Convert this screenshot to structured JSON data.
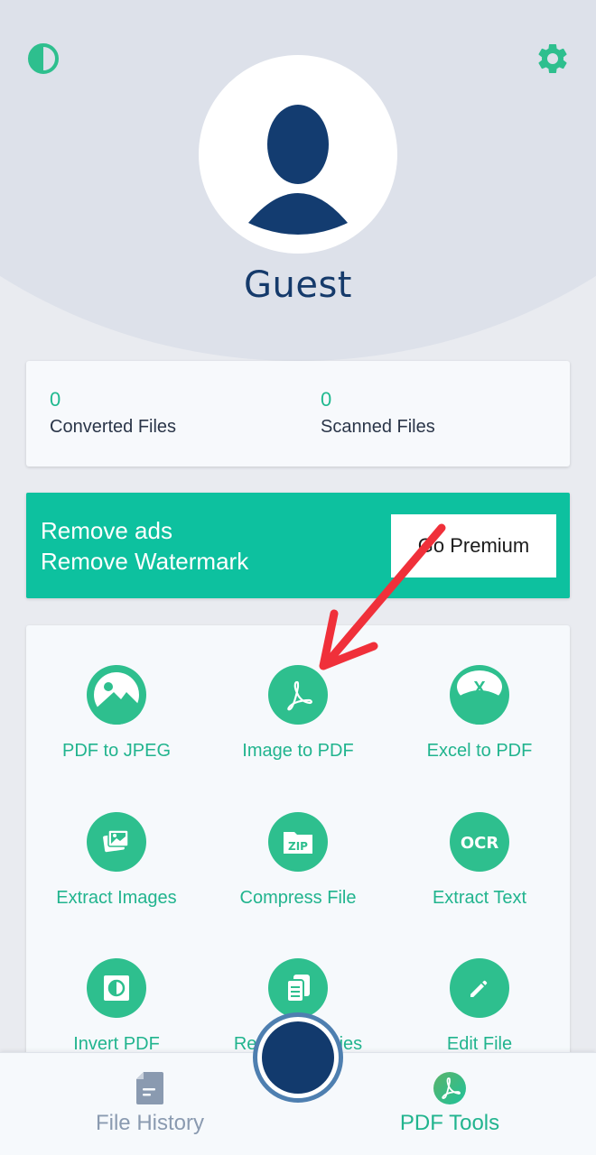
{
  "header": {
    "theme_toggle_icon": "contrast-icon",
    "settings_icon": "gear-icon",
    "avatar_icon": "user-icon",
    "user_name": "Guest"
  },
  "stats": [
    {
      "value": "0",
      "label": "Converted Files"
    },
    {
      "value": "0",
      "label": "Scanned Files"
    }
  ],
  "promo": {
    "line1": "Remove ads",
    "line2": "Remove Watermark",
    "button_label": "Go Premium"
  },
  "tools": [
    {
      "label": "PDF to JPEG",
      "icon": "image-icon"
    },
    {
      "label": "Image to PDF",
      "icon": "acrobat-icon"
    },
    {
      "label": "Excel to PDF",
      "icon": "excel-icon"
    },
    {
      "label": "Extract Images",
      "icon": "images-stack-icon"
    },
    {
      "label": "Compress File",
      "icon": "zip-icon"
    },
    {
      "label": "Extract Text",
      "icon": "ocr-icon"
    },
    {
      "label": "Invert PDF",
      "icon": "invert-icon"
    },
    {
      "label": "Remove Copies",
      "icon": "copies-icon"
    },
    {
      "label": "Edit File",
      "icon": "pencil-icon"
    }
  ],
  "bottom_nav": {
    "history_label": "File History",
    "tools_label": "PDF Tools",
    "active": "PDF Tools"
  },
  "colors": {
    "accent": "#2ebf8e",
    "promo_bg": "#0dc19f",
    "navy": "#153a6b",
    "annotation_arrow": "#f0303a"
  }
}
